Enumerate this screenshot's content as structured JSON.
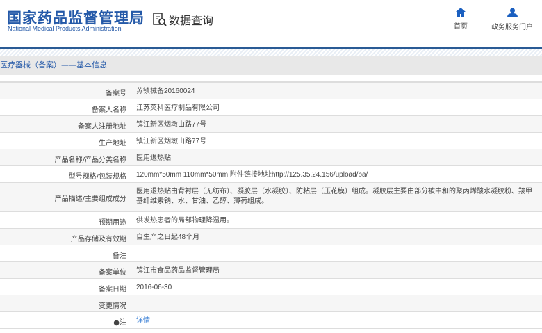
{
  "header": {
    "logo_cn": "国家药品监督管理局",
    "logo_en": "National Medical Products Administration",
    "query_title": "数据查询",
    "nav": [
      {
        "label": "首页",
        "icon": "home-icon"
      },
      {
        "label": "政务服务门户",
        "icon": "user-icon"
      }
    ]
  },
  "breadcrumb": "医疗器械（备案）——基本信息",
  "rows": [
    {
      "label": "备案号",
      "value": "苏镇械备20160024"
    },
    {
      "label": "备案人名称",
      "value": "江苏荚科医疗制品有限公司"
    },
    {
      "label": "备案人注册地址",
      "value": "镇江新区烟墩山路77号"
    },
    {
      "label": "生产地址",
      "value": "镇江新区烟墩山路77号"
    },
    {
      "label": "产品名称/产品分类名称",
      "value": "医用退热贴"
    },
    {
      "label": "型号规格/包装规格",
      "value": "120mm*50mm 110mm*50mm 附件链接地址http://125.35.24.156/upload/ba/"
    },
    {
      "label": "产品描述/主要组成成分",
      "value": "医用退热贴由背衬层（无纺布）、凝胶层（水凝胶）、防粘层（压花膜）组成。凝胶层主要由部分被中和的聚丙烯酸水凝胶粉、羧甲基纤维素钠、水、甘油、乙醇、薄荷组成。"
    },
    {
      "label": "预期用途",
      "value": "供发热患者的局部物理降温用。"
    },
    {
      "label": "产品存储及有效期",
      "value": "自生产之日起48个月"
    },
    {
      "label": "备注",
      "value": ""
    },
    {
      "label": "备案单位",
      "value": "镇江市食品药品监督管理局"
    },
    {
      "label": "备案日期",
      "value": "2016-06-30"
    },
    {
      "label": "变更情况",
      "value": ""
    },
    {
      "label": "注",
      "value": "详情"
    }
  ]
}
